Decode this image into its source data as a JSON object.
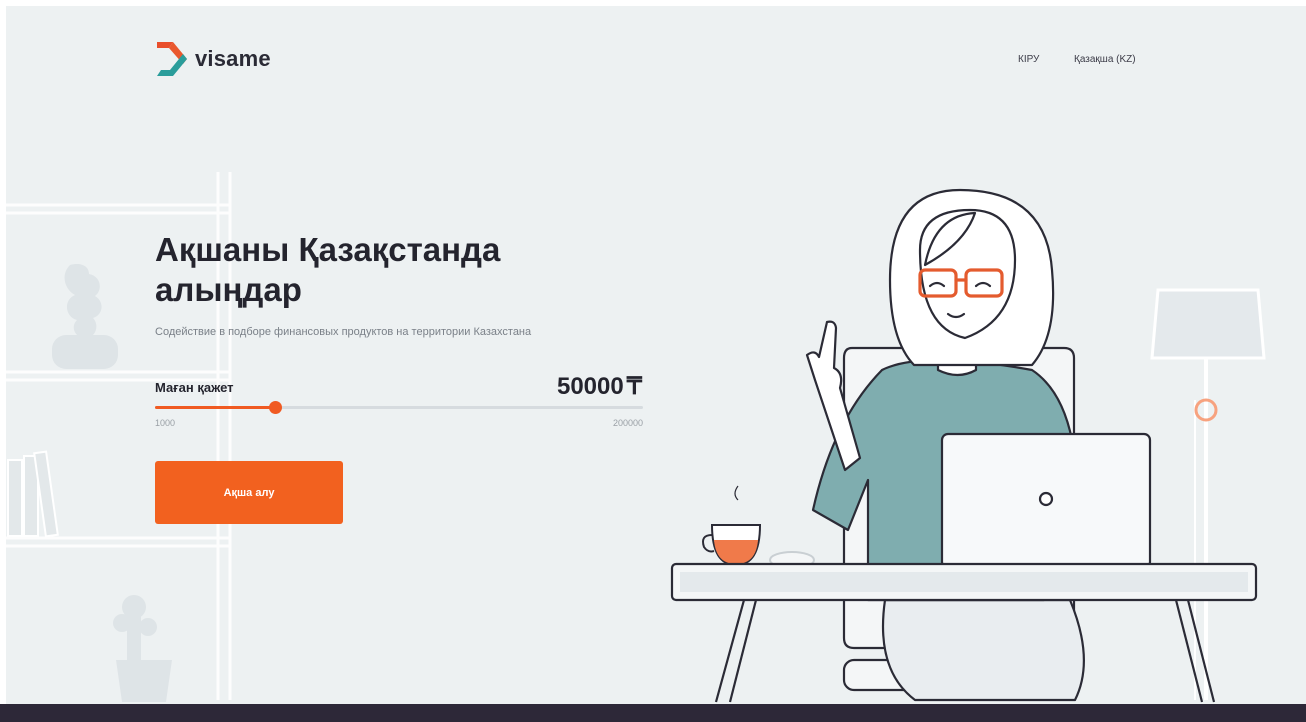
{
  "header": {
    "logo_text": "visame",
    "login_label": "КІРУ",
    "language_label": "Қазақша (KZ)"
  },
  "hero": {
    "title": "Ақшаны Қазақстанда алыңдар",
    "subtitle": "Содействие в подборе финансовых продуктов на территории Казахстана"
  },
  "amount": {
    "label": "Маған қажет",
    "value": "50000",
    "currency": "₸",
    "min_label": "1000",
    "max_label": "200000",
    "min": 1000,
    "max": 200000,
    "current": 50000
  },
  "cta": {
    "label": "Ақша алу"
  },
  "colors": {
    "accent": "#f05a22",
    "logo_teal": "#2a9d9b",
    "background": "#edf1f2",
    "footer": "#2d2838"
  },
  "icons": {
    "logo": "visame-chevron-logo"
  }
}
